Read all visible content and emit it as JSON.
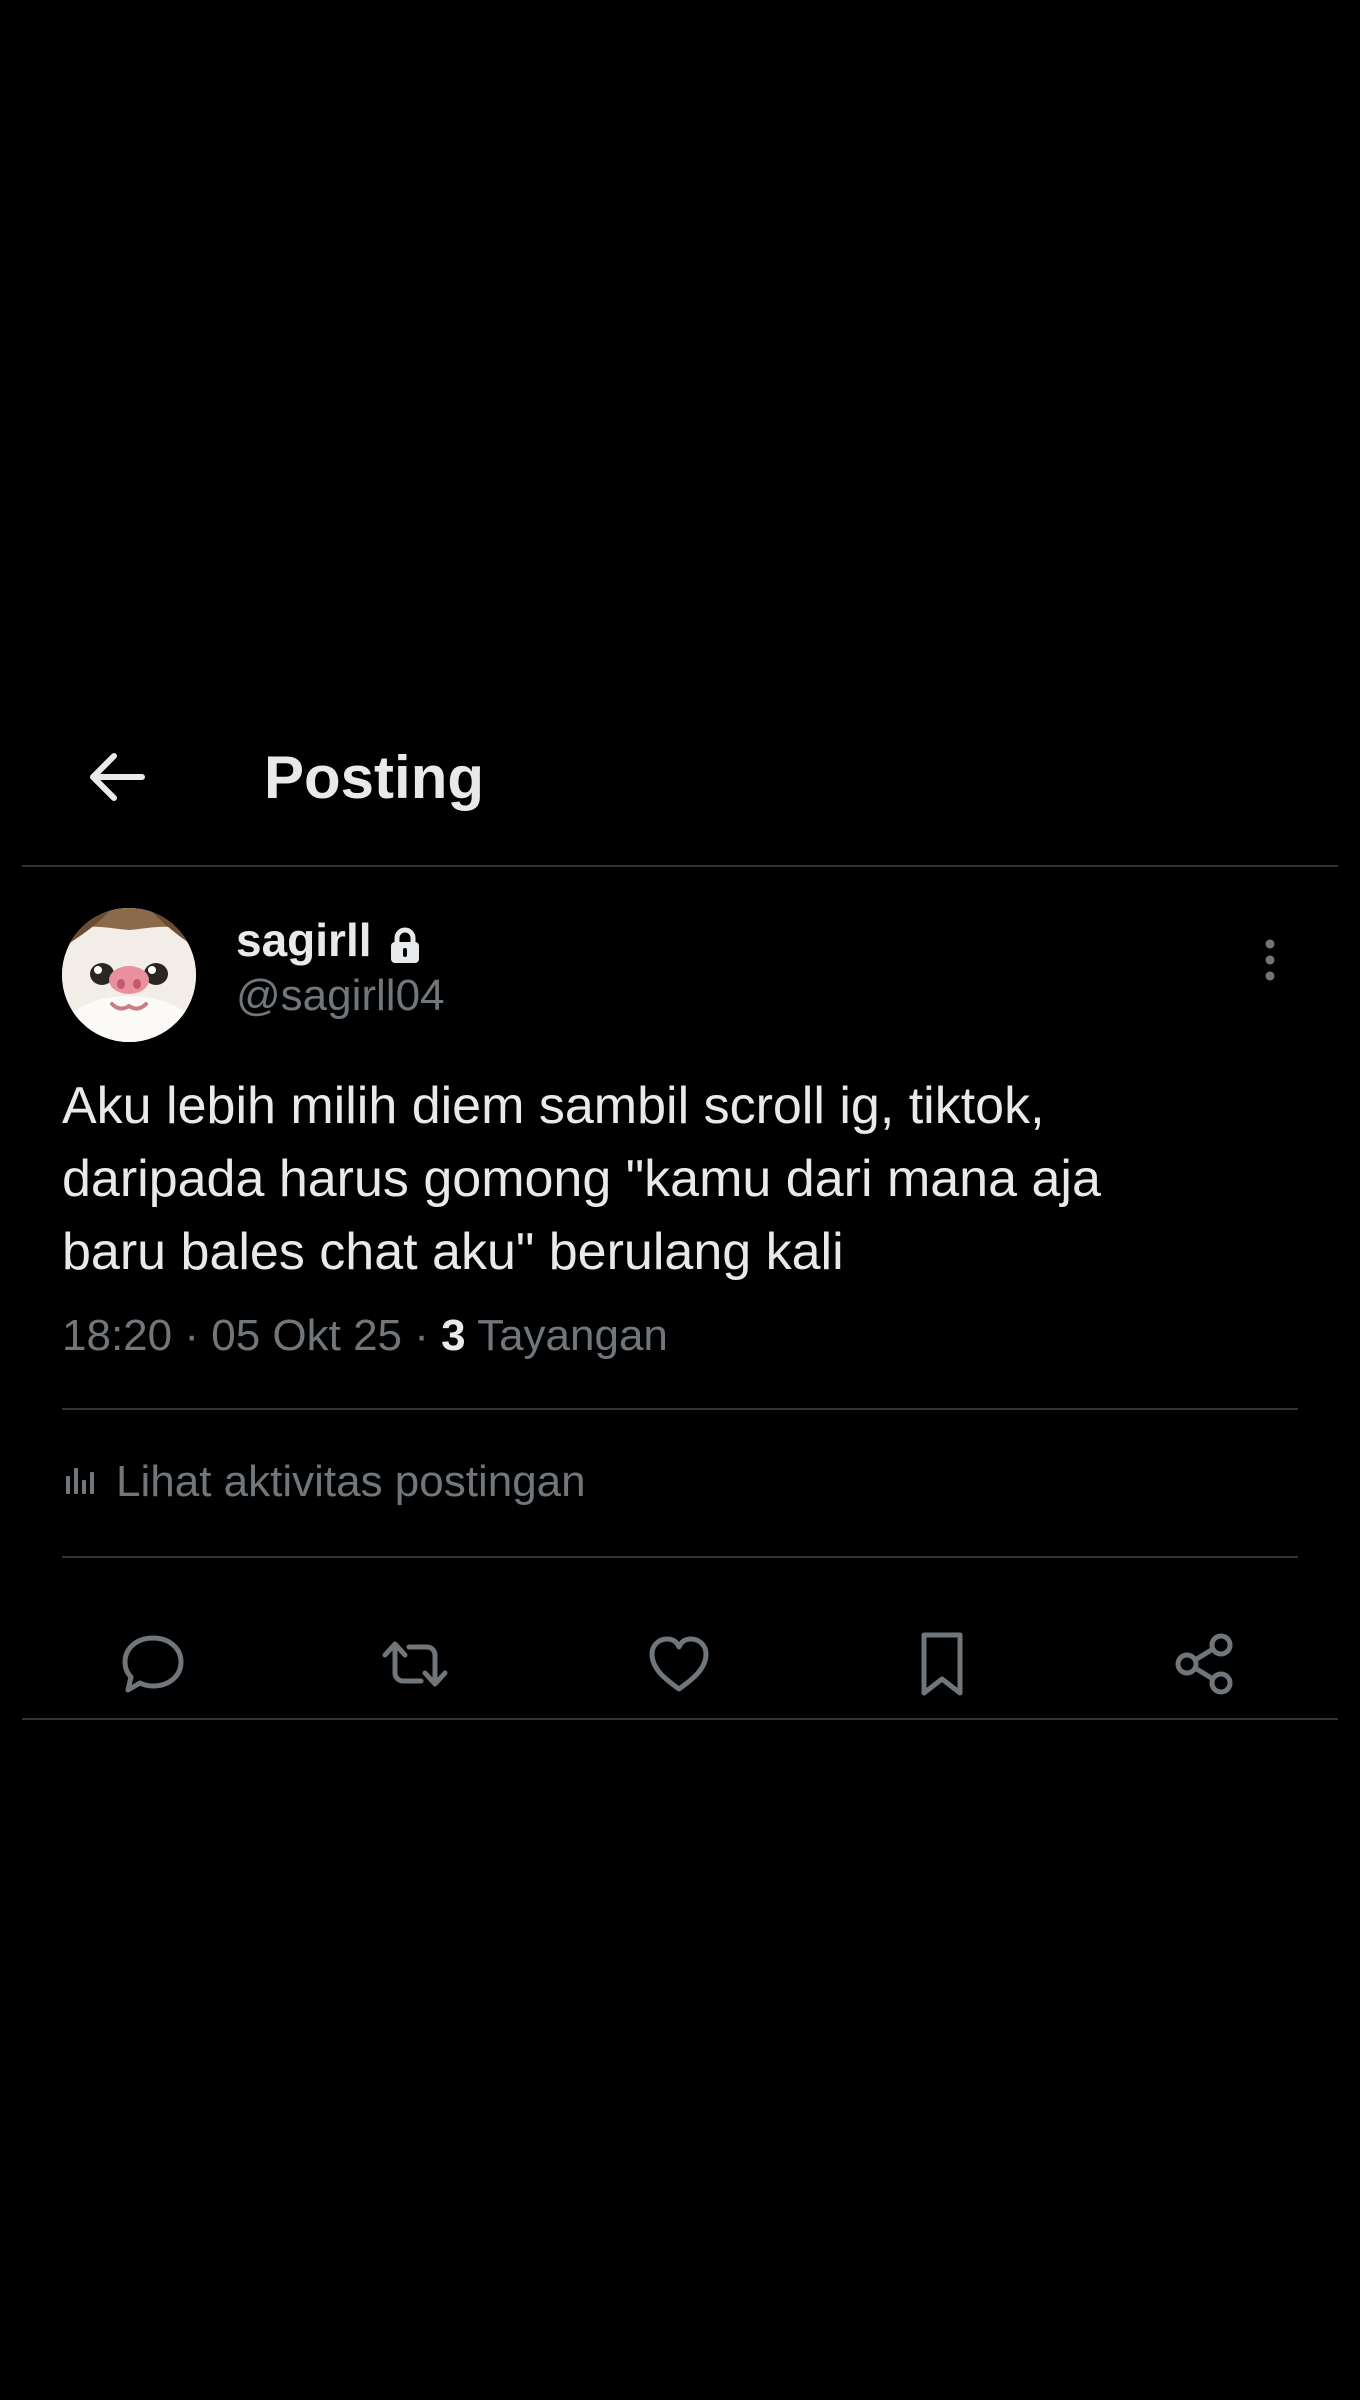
{
  "header": {
    "title": "Posting",
    "back_icon": "arrow-left-icon"
  },
  "post": {
    "author": {
      "display_name": "sagirll",
      "handle": "@sagirll04",
      "protected_icon": "lock-icon",
      "avatar_icon": "cat-face-avatar"
    },
    "text": "Aku lebih milih diem sambil scroll ig, tiktok,\ndaripada harus gomong \"kamu dari mana aja\nbaru bales chat aku\" berulang kali",
    "time": "18:20",
    "separator": "·",
    "date": "05 Okt 25",
    "views_count": "3",
    "views_label": "Tayangan",
    "more_icon": "more-vertical-icon"
  },
  "activity": {
    "label": "Lihat aktivitas postingan",
    "icon": "analytics-bar-icon"
  },
  "actions": [
    {
      "name": "reply",
      "icon": "reply-bubble-icon"
    },
    {
      "name": "repost",
      "icon": "repost-icon"
    },
    {
      "name": "like",
      "icon": "heart-icon"
    },
    {
      "name": "bookmark",
      "icon": "bookmark-icon"
    },
    {
      "name": "share",
      "icon": "share-icon"
    }
  ],
  "colors": {
    "background": "#000000",
    "text_primary": "#e7e9ea",
    "text_secondary": "#71767b",
    "divider": "#2f3336"
  }
}
